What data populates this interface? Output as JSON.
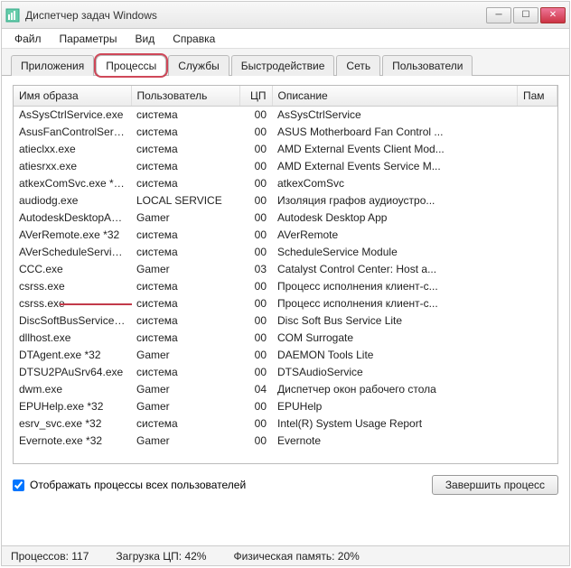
{
  "window": {
    "title": "Диспетчер задач Windows"
  },
  "menu": {
    "file": "Файл",
    "options": "Параметры",
    "view": "Вид",
    "help": "Справка"
  },
  "tabs": {
    "applications": "Приложения",
    "processes": "Процессы",
    "services": "Службы",
    "performance": "Быстродействие",
    "network": "Сеть",
    "users": "Пользователи"
  },
  "columns": {
    "name": "Имя образа",
    "user": "Пользователь",
    "cpu": "ЦП",
    "desc": "Описание",
    "mem": "Пам"
  },
  "rows": [
    {
      "name": "AsSysCtrlService.exe",
      "user": "система",
      "cpu": "00",
      "desc": "AsSysCtrlService"
    },
    {
      "name": "AsusFanControlServic...",
      "user": "система",
      "cpu": "00",
      "desc": "ASUS Motherboard Fan Control ..."
    },
    {
      "name": "atieclxx.exe",
      "user": "система",
      "cpu": "00",
      "desc": "AMD External Events Client Mod..."
    },
    {
      "name": "atiesrxx.exe",
      "user": "система",
      "cpu": "00",
      "desc": "AMD External Events Service M..."
    },
    {
      "name": "atkexComSvc.exe *32",
      "user": "система",
      "cpu": "00",
      "desc": "atkexComSvc"
    },
    {
      "name": "audiodg.exe",
      "user": "LOCAL SERVICE",
      "cpu": "00",
      "desc": "Изоляция графов аудиоустро..."
    },
    {
      "name": "AutodeskDesktopApp....",
      "user": "Gamer",
      "cpu": "00",
      "desc": "Autodesk Desktop App"
    },
    {
      "name": "AVerRemote.exe *32",
      "user": "система",
      "cpu": "00",
      "desc": "AVerRemote"
    },
    {
      "name": "AVerScheduleService....",
      "user": "система",
      "cpu": "00",
      "desc": "ScheduleService Module"
    },
    {
      "name": "CCC.exe",
      "user": "Gamer",
      "cpu": "03",
      "desc": "Catalyst Control Center: Host a..."
    },
    {
      "name": "csrss.exe",
      "user": "система",
      "cpu": "00",
      "desc": "Процесс исполнения клиент-с..."
    },
    {
      "name": "csrss.exe",
      "user": "система",
      "cpu": "00",
      "desc": "Процесс исполнения клиент-с..."
    },
    {
      "name": "DiscSoftBusServiceLit...",
      "user": "система",
      "cpu": "00",
      "desc": "Disc Soft Bus Service Lite"
    },
    {
      "name": "dllhost.exe",
      "user": "система",
      "cpu": "00",
      "desc": "COM Surrogate"
    },
    {
      "name": "DTAgent.exe *32",
      "user": "Gamer",
      "cpu": "00",
      "desc": "DAEMON Tools Lite"
    },
    {
      "name": "DTSU2PAuSrv64.exe",
      "user": "система",
      "cpu": "00",
      "desc": "DTSAudioService"
    },
    {
      "name": "dwm.exe",
      "user": "Gamer",
      "cpu": "04",
      "desc": "Диспетчер окон рабочего стола"
    },
    {
      "name": "EPUHelp.exe *32",
      "user": "Gamer",
      "cpu": "00",
      "desc": "EPUHelp"
    },
    {
      "name": "esrv_svc.exe *32",
      "user": "система",
      "cpu": "00",
      "desc": "Intel(R) System Usage Report"
    },
    {
      "name": "Evernote.exe *32",
      "user": "Gamer",
      "cpu": "00",
      "desc": "Evernote"
    }
  ],
  "checkbox": {
    "label": "Отображать процессы всех пользователей"
  },
  "button": {
    "end": "Завершить процесс"
  },
  "status": {
    "procs_label": "Процессов:",
    "procs": "117",
    "cpu_label": "Загрузка ЦП:",
    "cpu": "42%",
    "mem_label": "Физическая память:",
    "mem": "20%"
  }
}
